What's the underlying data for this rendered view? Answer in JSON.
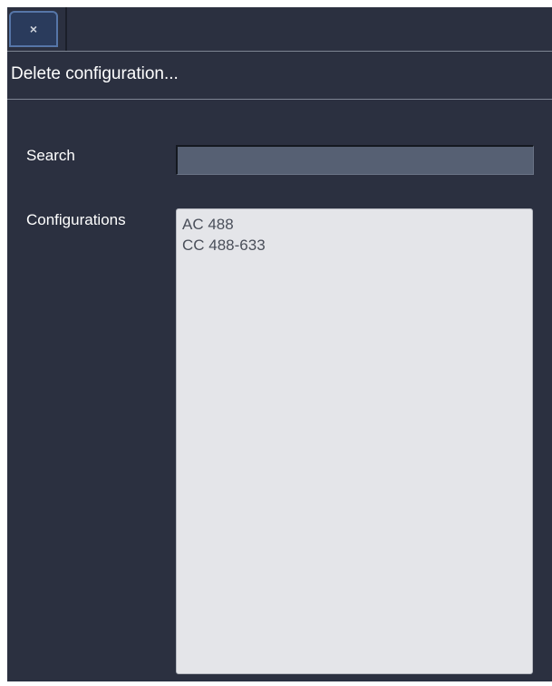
{
  "tab": {
    "close_glyph": "×",
    "close_icon": "close-icon"
  },
  "dialog": {
    "title": "Delete configuration..."
  },
  "form": {
    "search_label": "Search",
    "search_value": "",
    "configurations_label": "Configurations",
    "configurations": [
      "AC 488",
      "CC 488-633"
    ]
  },
  "colors": {
    "background": "#2b3040",
    "list_background": "#e4e5e9",
    "search_field": "#566073",
    "tab_border": "#5676a8"
  }
}
